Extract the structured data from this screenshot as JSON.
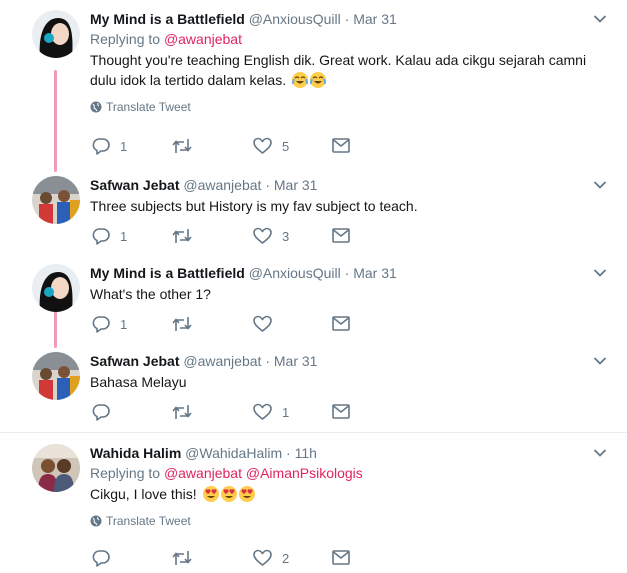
{
  "tweets": [
    {
      "name": "My Mind is a Battlefield",
      "handle": "@AnxiousQuill",
      "time": "Mar 31",
      "replying_prefix": "Replying to",
      "replying_to": [
        "@awanjebat"
      ],
      "text": "Thought you're teaching English dik. Great work. Kalau ada cikgu sejarah camni dulu idok la tertido dalam kelas.",
      "emojis": [
        "joy-emoji",
        "joy-emoji"
      ],
      "translate": "Translate Tweet",
      "reply_count": "1",
      "retweet_count": "",
      "like_count": "5"
    },
    {
      "name": "Safwan Jebat",
      "handle": "@awanjebat",
      "time": "Mar 31",
      "text": "Three subjects but History is my fav subject to teach.",
      "reply_count": "1",
      "retweet_count": "",
      "like_count": "3"
    },
    {
      "name": "My Mind is a Battlefield",
      "handle": "@AnxiousQuill",
      "time": "Mar 31",
      "text": "What's the other 1?",
      "reply_count": "1",
      "retweet_count": "",
      "like_count": ""
    },
    {
      "name": "Safwan Jebat",
      "handle": "@awanjebat",
      "time": "Mar 31",
      "text": "Bahasa Melayu",
      "reply_count": "",
      "retweet_count": "",
      "like_count": "1"
    },
    {
      "name": "Wahida Halim",
      "handle": "@WahidaHalim",
      "time": "11h",
      "replying_prefix": "Replying to",
      "replying_to": [
        "@awanjebat",
        "@AimanPsikologis"
      ],
      "text": "Cikgu, I love this!",
      "emojis": [
        "heart-eyes-emoji",
        "heart-eyes-emoji",
        "heart-eyes-emoji"
      ],
      "translate": "Translate Tweet",
      "reply_count": "",
      "retweet_count": "",
      "like_count": "2"
    }
  ],
  "separator": "·",
  "colors": {
    "text": "#14171a",
    "secondary": "#657786",
    "mention": "#e0245e",
    "divider": "#e6ecf0"
  },
  "icons": [
    "reply-icon",
    "retweet-icon",
    "like-icon",
    "share-icon",
    "chevron-down-icon",
    "globe-icon"
  ]
}
